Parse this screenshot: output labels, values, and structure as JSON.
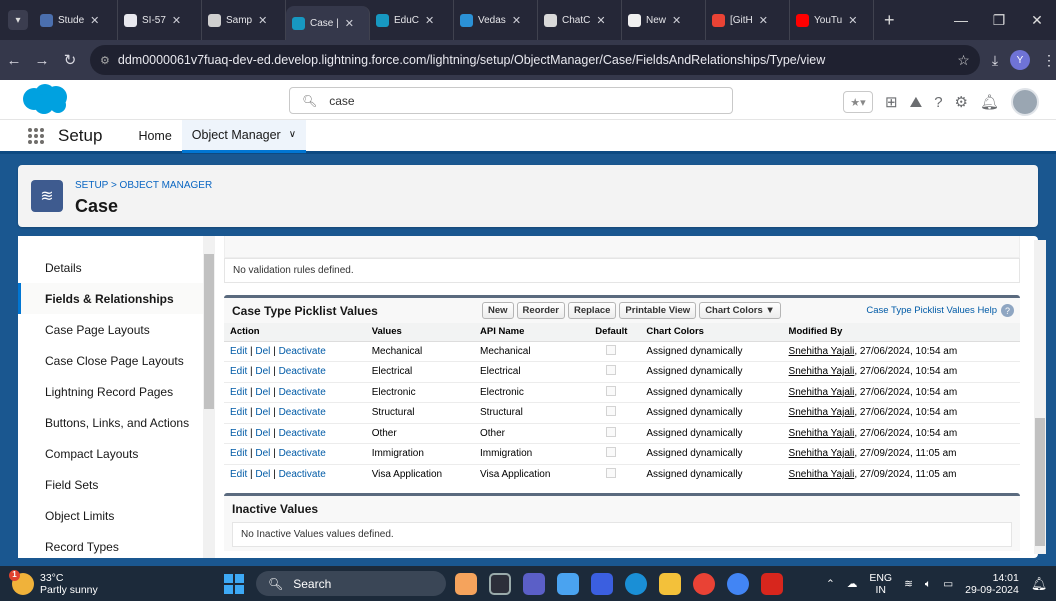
{
  "browser": {
    "tabs": [
      {
        "label": "Stude",
        "color": "#4b6fae"
      },
      {
        "label": "SI-57",
        "color": "#e8e8ee"
      },
      {
        "label": "Samp",
        "color": "#cfcfcf"
      },
      {
        "label": "Case |",
        "color": "#1798c1",
        "active": true
      },
      {
        "label": "EduC",
        "color": "#1798c1"
      },
      {
        "label": "Vedas",
        "color": "#2b91d6"
      },
      {
        "label": "ChatC",
        "color": "#d9d9d9"
      },
      {
        "label": "New",
        "color": "#f0f0f0"
      },
      {
        "label": "[GitH",
        "color": "#ea4335"
      },
      {
        "label": "YouTu",
        "color": "#ff0000"
      }
    ],
    "url": "ddm0000061v7fuaq-dev-ed.develop.lightning.force.com/lightning/setup/ObjectManager/Case/FieldsAndRelationships/Type/view",
    "profile_initial": "Y"
  },
  "header": {
    "search_value": "case",
    "brand_color": "#00a1e0"
  },
  "nav": {
    "app_name": "Setup",
    "items": [
      "Home",
      "Object Manager"
    ]
  },
  "page_header": {
    "breadcrumb": "SETUP > OBJECT MANAGER",
    "title": "Case"
  },
  "sidebar": {
    "items": [
      "Details",
      "Fields & Relationships",
      "Case Page Layouts",
      "Case Close Page Layouts",
      "Lightning Record Pages",
      "Buttons, Links, and Actions",
      "Compact Layouts",
      "Field Sets",
      "Object Limits",
      "Record Types"
    ],
    "selected_index": 1
  },
  "validation": {
    "empty_text": "No validation rules defined."
  },
  "picklist": {
    "title": "Case Type Picklist Values",
    "buttons": [
      "New",
      "Reorder",
      "Replace",
      "Printable View",
      "Chart Colors ▼"
    ],
    "help_text": "Case Type Picklist Values Help",
    "columns": [
      "Action",
      "Values",
      "API Name",
      "Default",
      "Chart Colors",
      "Modified By"
    ],
    "action_links": [
      "Edit",
      "Del",
      "Deactivate"
    ],
    "rows": [
      {
        "value": "Mechanical",
        "api": "Mechanical",
        "colors": "Assigned dynamically",
        "by": "Snehitha Yajali",
        "date": ", 27/06/2024, 10:54 am"
      },
      {
        "value": "Electrical",
        "api": "Electrical",
        "colors": "Assigned dynamically",
        "by": "Snehitha Yajali",
        "date": ", 27/06/2024, 10:54 am"
      },
      {
        "value": "Electronic",
        "api": "Electronic",
        "colors": "Assigned dynamically",
        "by": "Snehitha Yajali",
        "date": ", 27/06/2024, 10:54 am"
      },
      {
        "value": "Structural",
        "api": "Structural",
        "colors": "Assigned dynamically",
        "by": "Snehitha Yajali",
        "date": ", 27/06/2024, 10:54 am"
      },
      {
        "value": "Other",
        "api": "Other",
        "colors": "Assigned dynamically",
        "by": "Snehitha Yajali",
        "date": ", 27/06/2024, 10:54 am"
      },
      {
        "value": "Immigration",
        "api": "Immigration",
        "colors": "Assigned dynamically",
        "by": "Snehitha Yajali",
        "date": ", 27/09/2024, 11:05 am"
      },
      {
        "value": "Visa Application",
        "api": "Visa Application",
        "colors": "Assigned dynamically",
        "by": "Snehitha Yajali",
        "date": ", 27/09/2024, 11:05 am"
      }
    ]
  },
  "inactive": {
    "title": "Inactive Values",
    "empty_text": "No Inactive Values values defined."
  },
  "taskbar": {
    "temp": "33°C",
    "weather": "Partly sunny",
    "badge": "1",
    "search": "Search",
    "lang1": "ENG",
    "lang2": "IN",
    "time": "14:01",
    "date": "29-09-2024"
  }
}
